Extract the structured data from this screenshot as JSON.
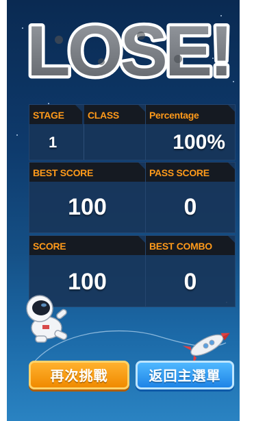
{
  "result": {
    "title": "LOSE!"
  },
  "stats": {
    "stage": {
      "label": "STAGE",
      "value": "1"
    },
    "class": {
      "label": "CLASS",
      "value": ""
    },
    "percentage": {
      "label": "Percentage",
      "value": "100%"
    },
    "best_score": {
      "label": "BEST SCORE",
      "value": "100"
    },
    "pass_score": {
      "label": "PASS SCORE",
      "value": "0"
    },
    "score": {
      "label": "SCORE",
      "value": "100"
    },
    "best_combo": {
      "label": "BEST COMBO",
      "value": "0"
    }
  },
  "buttons": {
    "retry_label": "再次挑戰",
    "main_menu_label": "返回主選單"
  },
  "colors": {
    "label_orange": "#ff9a1a",
    "retry_orange": "#f08a00",
    "menu_blue": "#1e84e6"
  },
  "icons": [
    "astronaut-icon",
    "rocket-icon"
  ]
}
